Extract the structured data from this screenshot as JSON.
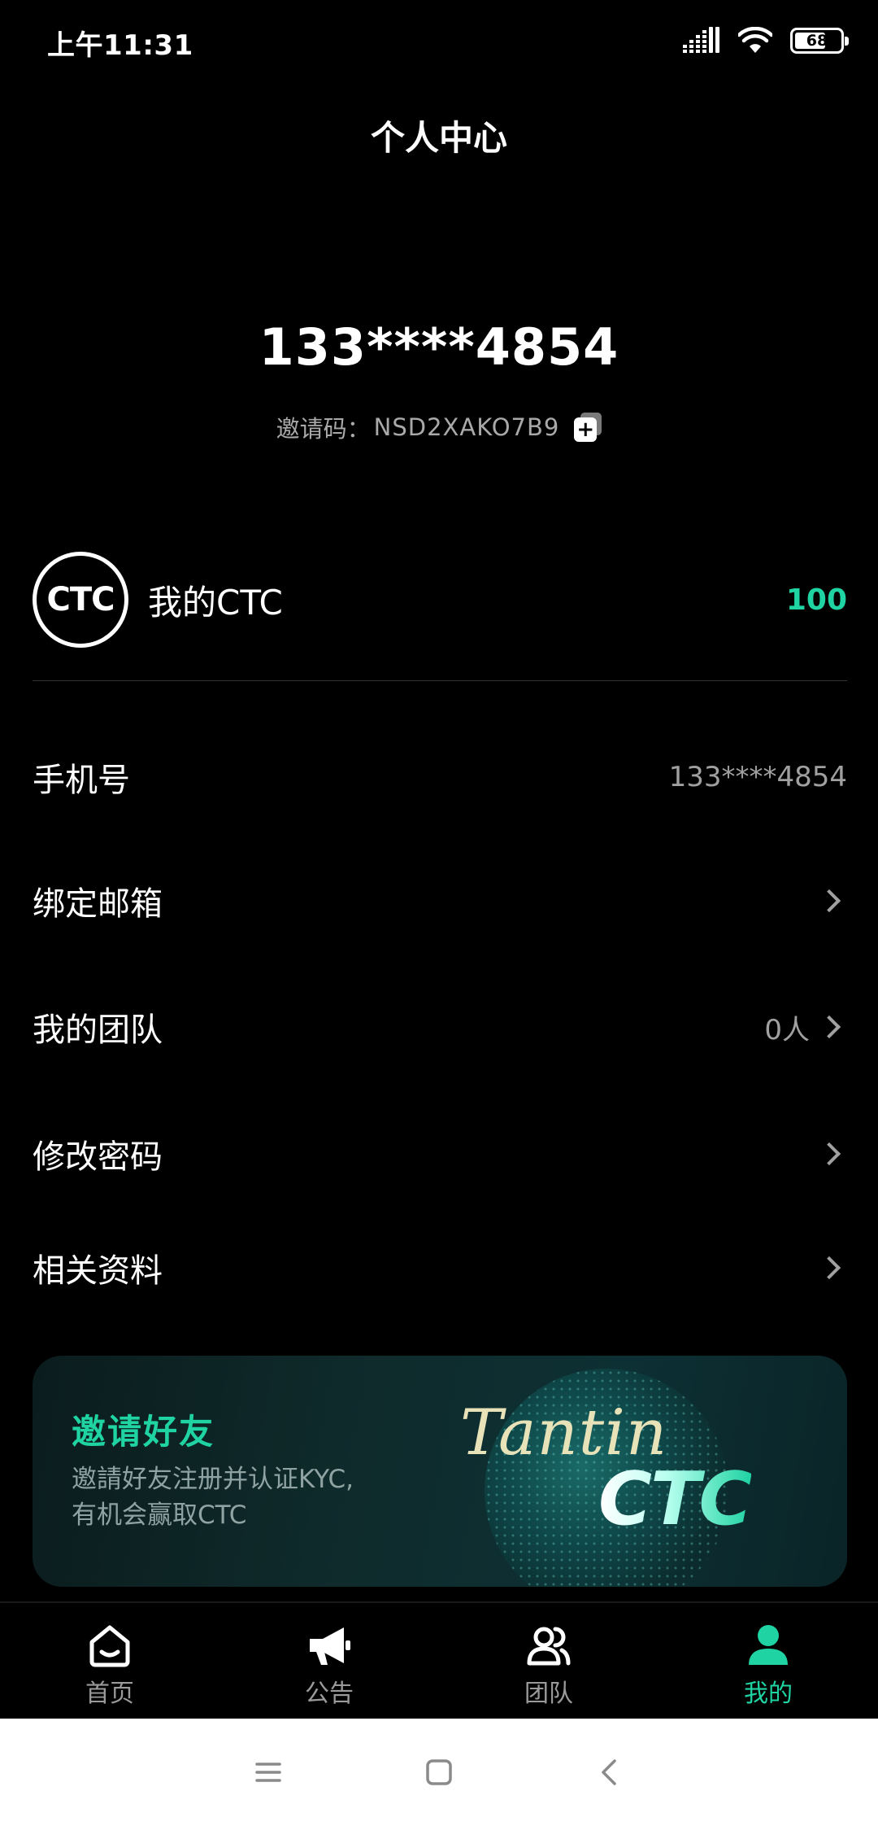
{
  "status_bar": {
    "time": "上午11:31",
    "battery": "68",
    "battery_level_percent": 68
  },
  "header": {
    "title": "个人中心"
  },
  "account": {
    "phone": "133****4854",
    "invite_label": "邀请码：",
    "invite_code": "NSD2XAKO7B9"
  },
  "ctc": {
    "logo_text": "CTC",
    "label": "我的CTC",
    "balance": "100"
  },
  "menu": {
    "items": [
      {
        "label": "手机号",
        "value": "133****4854",
        "chevron": false
      },
      {
        "label": "绑定邮箱",
        "value": "",
        "chevron": true
      },
      {
        "label": "我的团队",
        "value": "0人",
        "chevron": true
      },
      {
        "label": "修改密码",
        "value": "",
        "chevron": true
      },
      {
        "label": "相关资料",
        "value": "",
        "chevron": true
      }
    ]
  },
  "banner": {
    "title": "邀请好友",
    "desc_line1": "邀請好友注册并认证KYC,",
    "desc_line2": "有机会赢取CTC",
    "brand_script": "Tantin",
    "brand_mark": "CTC"
  },
  "bottom_nav": {
    "items": [
      {
        "label": "首页",
        "icon": "home-icon",
        "active": false
      },
      {
        "label": "公告",
        "icon": "megaphone-icon",
        "active": false
      },
      {
        "label": "团队",
        "icon": "team-icon",
        "active": false
      },
      {
        "label": "我的",
        "icon": "profile-icon",
        "active": true
      }
    ]
  },
  "colors": {
    "accent": "#1fd3a2",
    "background": "#000000",
    "muted": "#a0a0a0"
  }
}
